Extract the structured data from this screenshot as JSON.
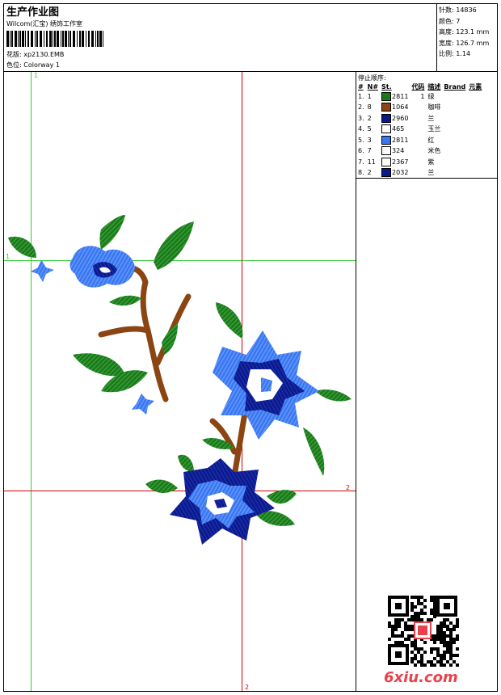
{
  "header": {
    "title": "生产作业图",
    "studio": "Wilcom(汇宝) 绣饰工作室",
    "design_label": "花版: xp2130.EMB",
    "colorway_label": "色位: Colorway 1"
  },
  "stats": [
    "针数: 14836",
    "颜色: 7",
    "高度: 123.1 mm",
    "宽度: 126.7 mm",
    "比例: 1.14"
  ],
  "stop_sequence": {
    "title": "停止顺序:",
    "headers": [
      "#",
      "N#",
      "St.",
      "代码",
      "描述",
      "Brand",
      "元素"
    ],
    "rows": [
      {
        "idx": "1.",
        "n": "1",
        "color": "#1a7a1a",
        "code": "2811",
        "st": "1",
        "desc": "绿"
      },
      {
        "idx": "2.",
        "n": "8",
        "color": "#8b4513",
        "code": "1064",
        "st": "",
        "desc": "咖啡"
      },
      {
        "idx": "3.",
        "n": "2",
        "color": "#0a1a8a",
        "code": "2960",
        "st": "",
        "desc": "兰"
      },
      {
        "idx": "4.",
        "n": "5",
        "color": "#ffffff",
        "code": "465",
        "st": "",
        "desc": "玉兰"
      },
      {
        "idx": "5.",
        "n": "3",
        "color": "#3a78f0",
        "code": "2811",
        "st": "",
        "desc": "红"
      },
      {
        "idx": "6.",
        "n": "7",
        "color": "#ffffff",
        "code": "324",
        "st": "",
        "desc": "米色"
      },
      {
        "idx": "7.",
        "n": "11",
        "color": "#ffffff",
        "code": "2367",
        "st": "",
        "desc": "紫"
      },
      {
        "idx": "8.",
        "n": "2",
        "color": "#0a1a8a",
        "code": "2032",
        "st": "",
        "desc": "兰"
      }
    ]
  },
  "guides": {
    "green_1": "1",
    "green_1b": "1",
    "red_2": "2",
    "red_2b": "2"
  },
  "watermark": {
    "site": "6xiu.com"
  },
  "colors": {
    "green": "#1a7a1a",
    "brown": "#8b4513",
    "navy": "#0a1a8a",
    "blue": "#3a78f0",
    "guide_green": "#2ecc2e",
    "guide_red": "#d20000"
  }
}
